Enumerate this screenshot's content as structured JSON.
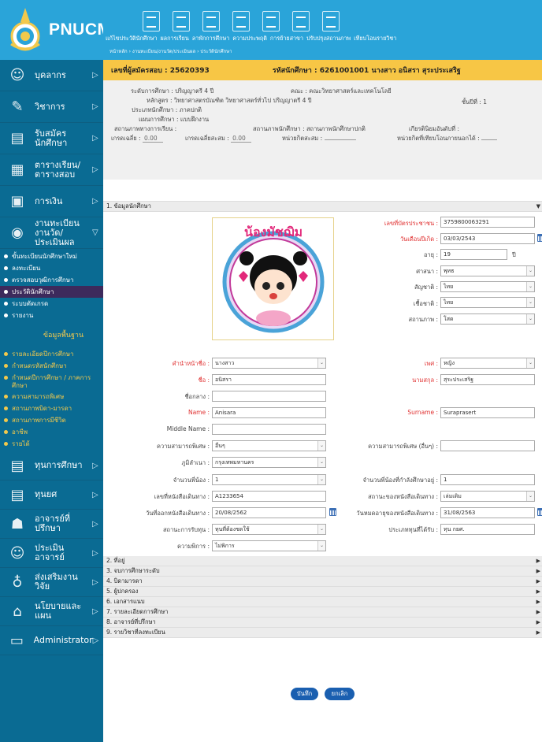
{
  "brand": {
    "name": "PNUCM"
  },
  "sidebar": {
    "items": [
      {
        "label": "บุคลากร",
        "icon": "person-icon"
      },
      {
        "label": "วิชาการ",
        "icon": "teacher-icon"
      },
      {
        "label": "รับสมัครนักศึกษา",
        "icon": "document-icon"
      },
      {
        "label": "ตารางเรียน/ ตารางสอบ",
        "icon": "calendar-icon"
      },
      {
        "label": "การเงิน",
        "icon": "money-icon"
      },
      {
        "label": "งานทะเบียน งานวัด/ประเมินผล",
        "icon": "registration-icon"
      }
    ],
    "reg_sub": [
      "ขั้นทะเบียนนักศึกษาใหม่",
      "ลงทะเบียน",
      "ตรวจสอบวุฒิการศึกษา",
      "ประวัตินักศึกษา",
      "ระบบตัดเกรด",
      "รายงาน"
    ],
    "base_title": "ข้อมูลพื้นฐาน",
    "base_sub": [
      "รายละเอียดปีการศึกษา",
      "กำหนดรหัสนักศึกษา",
      "กำหนดปีการศึกษา / ภาคการศึกษา",
      "ความสามารถพิเศษ",
      "สถานภาพบิดา-มารดา",
      "สถานภาพการมีชีวิต",
      "อาชีพ",
      "รายได้"
    ],
    "items2": [
      {
        "label": "ทุนการศึกษา",
        "icon": "scholarship-icon"
      },
      {
        "label": "ทุนยศ",
        "icon": "rank-icon"
      },
      {
        "label": "อาจารย์ที่ปรึกษา",
        "icon": "advisor-icon"
      },
      {
        "label": "ประเมินอาจารย์",
        "icon": "evaluation-icon"
      },
      {
        "label": "ส่งเสริมงานวิจัย",
        "icon": "research-icon"
      },
      {
        "label": "นโยบายและแผน",
        "icon": "policy-icon"
      },
      {
        "label": "Administrator",
        "icon": "monitor-icon"
      }
    ]
  },
  "topnav": [
    "แก้ไขประวัตินักศึกษา",
    "ผลการเรียน",
    "ลาพักการศึกษา",
    "ความประพฤติ",
    "การย้ายสาขา",
    "ปรับปรุงสถานภาพ",
    "เทียบโอนรายวิชา"
  ],
  "breadcrumb": "หน้าหลัก › งานทะเบียน/งานวัด/ประเมินผล › ประวัตินักศึกษา",
  "header": {
    "applicant": "เลขที่ผู้สมัครสอบ : 25620393",
    "student": "รหัสนักศึกษา : 6261001001 นางสาว อนิสรา สุระประเสริฐ"
  },
  "info": {
    "level": "ระดับการศึกษา : ปริญญาตรี 4 ปี",
    "faculty": "คณะ : คณะวิทยาศาสตร์และเทคโนโลยี",
    "program": "หลักสูตร : วิทยาศาสตรบัณฑิต วิทยาศาสตร์ทั่วไป ปริญญาตรี 4 ปี",
    "year": "ชั้นปีที่ : 1",
    "type": "ประเภทนักศึกษา : ภาคปกติ",
    "plan": "แผนการศึกษา : แบบฝึกงาน",
    "edu_status": "สถานภาพทางการเรียน :",
    "stu_status": "สถานภาพนักศึกษา : สถานภาพนักศึกษาปกติ",
    "honor": "เกียรตินิยมอันดับที่ :",
    "gpa_label": "เกรดเฉลี่ย :",
    "gpa": "0.00",
    "cgpa_label": "เกรดเฉลี่ยสะสม :",
    "cgpa": "0.00",
    "credits": "หน่วยกิตสะสม :",
    "transfer": "หน่วยกิตที่เทียบโอนภายนอกได้ :"
  },
  "sections": [
    "1. ข้อมูลนักศึกษา",
    "2. ที่อยู่",
    "3. จบการศึกษาระดับ",
    "4. บิดามารดา",
    "5. ผู้ปกครอง",
    "6. เอกสารแนบ",
    "7. รายละเอียดการศึกษา",
    "8. อาจารย์ที่ปรึกษา",
    "9. รายวิชาที่ลงทะเบียน"
  ],
  "photo_caption": "น้องมัชฌิม",
  "form": {
    "id_card_label": "เลขที่บัตรประชาชน :",
    "id_card": "3759800063291",
    "dob_label": "วันเดือนปีเกิด :",
    "dob": "03/03/2543",
    "age_label": "อายุ :",
    "age": "19",
    "age_unit": "ปี",
    "religion_label": "ศาสนา :",
    "religion": "พุทธ",
    "nationality_label": "สัญชาติ :",
    "nationality": "ไทย",
    "ethnicity_label": "เชื้อชาติ :",
    "ethnicity": "ไทย",
    "marital_label": "สถานภาพ :",
    "marital": "โสด",
    "prefix_label": "คำนำหน้าชื่อ :",
    "prefix": "นางสาว",
    "gender_label": "เพศ :",
    "gender": "หญิง",
    "fname_label": "ชื่อ :",
    "fname": "อนิสรา",
    "lname_label": "นามสกุล :",
    "lname": "สุระประเสริฐ",
    "mname_label": "ชื่อกลาง :",
    "mname": "",
    "name_en_label": "Name :",
    "name_en": "Anisara",
    "surname_en_label": "Surname :",
    "surname_en": "Suraprasert",
    "mname_en_label": "Middle Name :",
    "mname_en": "",
    "talent_label": "ความสามารถพิเศษ :",
    "talent": "อื่นๆ",
    "talent_other_label": "ความสามารถพิเศษ (อื่นๆ) :",
    "talent_other": "",
    "hometown_label": "ภูมิลำเนา :",
    "hometown": "กรุงเทพมหานคร",
    "siblings_label": "จำนวนพี่น้อง :",
    "siblings": "1",
    "siblings_study_label": "จำนวนพี่น้องที่กำลังศึกษาอยู่ :",
    "siblings_study": "1",
    "passport_label": "เลขที่หนังสือเดินทาง :",
    "passport": "A1233654",
    "passport_status_label": "สถานะของหนังสือเดินทาง :",
    "passport_status": "เล่มเดิม",
    "issue_label": "วันที่ออกหนังสือเดินทาง :",
    "issue": "20/08/2562",
    "expire_label": "วันหมดอายุของหนังสือเดินทาง :",
    "expire": "31/08/2563",
    "aid_label": "สถานะการรับทุน :",
    "aid": "ทุนที่ต้องชดใช้",
    "aid_type_label": "ประเภททุนที่ได้รับ :",
    "aid_type": "ทุน กยศ.",
    "disability_label": "ความพิการ :",
    "disability": "ไม่พิการ"
  },
  "buttons": {
    "save": "บันทึก",
    "cancel": "ยกเลิก"
  }
}
